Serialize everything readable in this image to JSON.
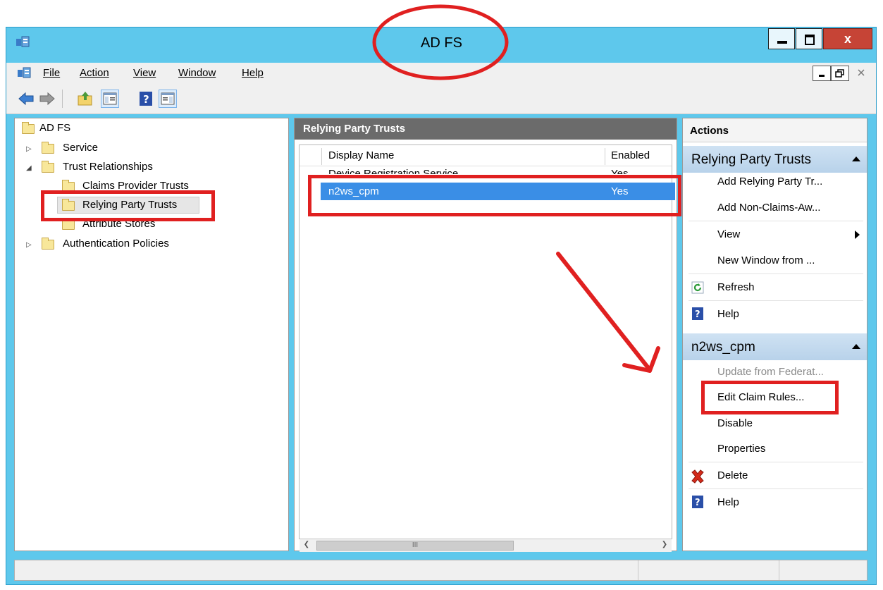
{
  "window": {
    "title": "AD FS",
    "close_glyph": "x"
  },
  "menubar": {
    "items": [
      {
        "label": "File"
      },
      {
        "label": "Action"
      },
      {
        "label": "View"
      },
      {
        "label": "Window"
      },
      {
        "label": "Help"
      }
    ]
  },
  "toolbar": {
    "icons": [
      "back-arrow-icon",
      "forward-arrow-icon",
      "up-folder-icon",
      "show-hide-console-tree-icon",
      "help-icon",
      "show-hide-action-pane-icon"
    ]
  },
  "tree": {
    "root": "AD FS",
    "items": [
      {
        "label": "Service"
      },
      {
        "label": "Trust Relationships"
      },
      {
        "label": "Claims Provider Trusts"
      },
      {
        "label": "Relying Party Trusts"
      },
      {
        "label": "Attribute Stores"
      },
      {
        "label": "Authentication Policies"
      }
    ]
  },
  "middle": {
    "header": "Relying Party Trusts",
    "columns": [
      "Display Name",
      "Enabled"
    ],
    "rows": [
      {
        "name": "Device Registration Service",
        "enabled": "Yes"
      },
      {
        "name": "n2ws_cpm",
        "enabled": "Yes"
      }
    ],
    "scroll_mark": "III"
  },
  "actions": {
    "title": "Actions",
    "section1": {
      "label": "Relying Party Trusts",
      "items": [
        {
          "label": "Add Relying Party Tr..."
        },
        {
          "label": "Add Non-Claims-Aw..."
        },
        {
          "label": "View"
        },
        {
          "label": "New Window from ..."
        },
        {
          "label": "Refresh"
        },
        {
          "label": "Help"
        }
      ]
    },
    "section2": {
      "label": "n2ws_cpm",
      "items": [
        {
          "label": "Update from Federat..."
        },
        {
          "label": "Edit Claim Rules..."
        },
        {
          "label": "Disable"
        },
        {
          "label": "Properties"
        },
        {
          "label": "Delete"
        },
        {
          "label": "Help"
        }
      ]
    }
  },
  "colors": {
    "title_bar": "#5ec8ec",
    "selection": "#3a8ee6",
    "annotation": "#e02020",
    "close_button": "#c64436"
  }
}
